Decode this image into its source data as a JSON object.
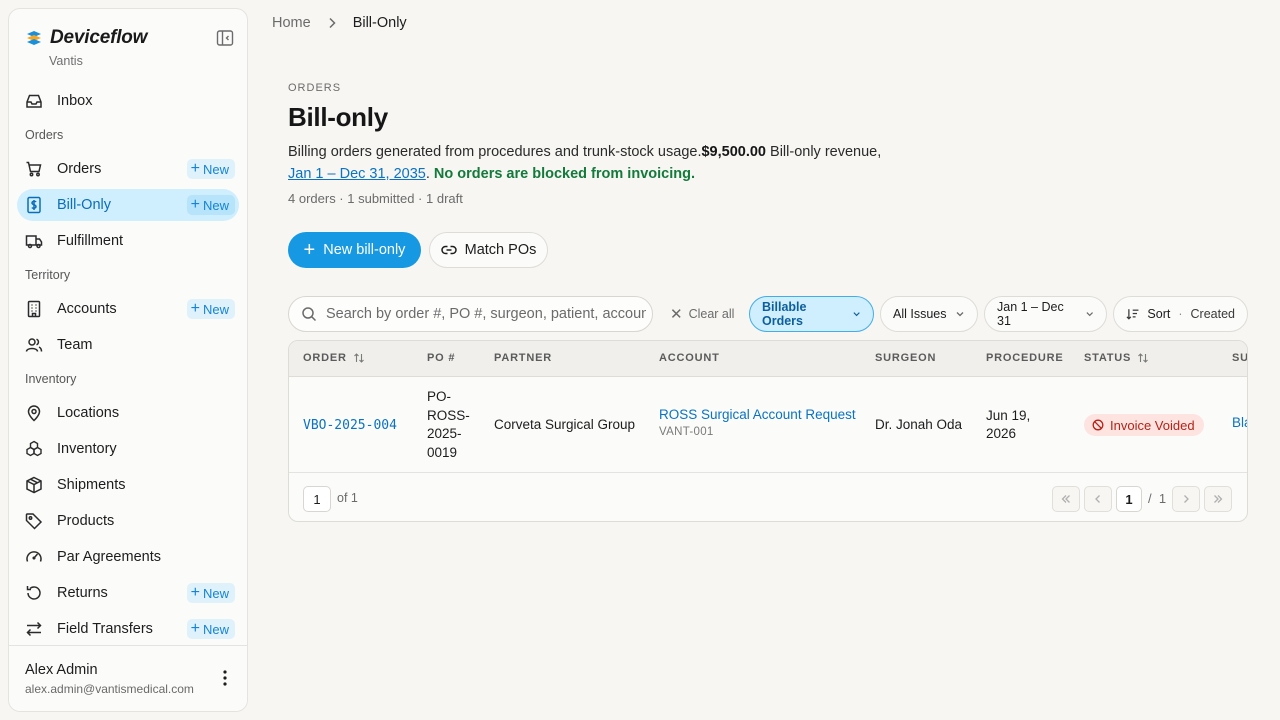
{
  "brand": {
    "name": "Deviceflow",
    "org": "Vantis"
  },
  "sidebar": {
    "inbox": "Inbox",
    "section_orders": "Orders",
    "orders": "Orders",
    "bill_only": "Bill-Only",
    "fulfillment": "Fulfillment",
    "section_territory": "Territory",
    "accounts": "Accounts",
    "team": "Team",
    "section_inventory": "Inventory",
    "locations": "Locations",
    "inventory": "Inventory",
    "shipments": "Shipments",
    "products": "Products",
    "par_agreements": "Par Agreements",
    "returns": "Returns",
    "field_transfers": "Field Transfers",
    "new_label": "New"
  },
  "user": {
    "name": "Alex Admin",
    "email": "alex.admin@vantismedical.com"
  },
  "breadcrumb": {
    "home": "Home",
    "current": "Bill-Only"
  },
  "page": {
    "eyebrow": "ORDERS",
    "title": "Bill-only",
    "desc_prefix": "Billing orders generated from procedures and trunk-stock usage.",
    "revenue_amount": "$9,500.00",
    "revenue_suffix": " Bill-only revenue,",
    "date_range": "Jan 1 – Dec 31, 2035",
    "period": ".",
    "blocked_note": "No orders are blocked from invoicing.",
    "summary": "4 orders · 1 submitted · 1 draft"
  },
  "actions": {
    "new_bill_only": "New bill-only",
    "match_pos": "Match POs"
  },
  "filters": {
    "search_placeholder": "Search by order #, PO #, surgeon, patient, account",
    "clear_all": "Clear all",
    "view": "Billable Orders",
    "issues": "All Issues",
    "dates": "Jan 1 – Dec 31",
    "sort_label": "Sort",
    "sort_value": "Created"
  },
  "table": {
    "columns": [
      "ORDER",
      "PO #",
      "PARTNER",
      "ACCOUNT",
      "SURGEON",
      "PROCEDURE",
      "STATUS",
      "SU"
    ],
    "rows": [
      {
        "order": "VBO-2025-004",
        "po_lines": [
          "PO-",
          "ROSS-",
          "2025-",
          "0019"
        ],
        "partner": "Corveta Surgical Group",
        "account": "ROSS Surgical Account Request",
        "account_code": "VANT-001",
        "surgeon": "Dr. Jonah Oda",
        "procedure_lines": [
          "Jun 19,",
          "2026"
        ],
        "status": "Invoice Voided",
        "submitter": "Bla"
      }
    ]
  },
  "pagination": {
    "page": "1",
    "of_text": "of 1",
    "current": "1",
    "slash": "/",
    "total": "1"
  },
  "colors": {
    "accent": "#1699e2",
    "active_nav": "#cfeefe",
    "status_voided": "#b42318",
    "success": "#137a3b"
  }
}
